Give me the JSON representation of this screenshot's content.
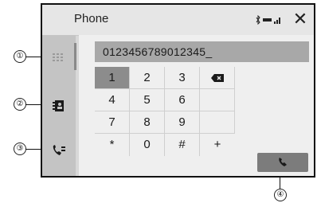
{
  "header": {
    "title": "Phone",
    "close_label": "✕"
  },
  "number_field": {
    "value": "0123456789012345_"
  },
  "keypad": {
    "rows": [
      [
        "1",
        "2",
        "3",
        "⌫"
      ],
      [
        "4",
        "5",
        "6",
        ""
      ],
      [
        "7",
        "8",
        "9",
        ""
      ],
      [
        "*",
        "0",
        "#",
        "+"
      ]
    ],
    "selected": "1"
  },
  "sidebar": {
    "items": [
      {
        "icon": "dialpad-icon"
      },
      {
        "icon": "phonebook-icon"
      },
      {
        "icon": "call-history-icon"
      }
    ]
  },
  "call_button": {
    "icon": "call-icon"
  },
  "callouts": [
    "①",
    "②",
    "③",
    "④"
  ],
  "colors": {
    "selected_key": "#8c8c8c",
    "call_button": "#7c7c7c",
    "number_field": "#a8a8a8"
  }
}
